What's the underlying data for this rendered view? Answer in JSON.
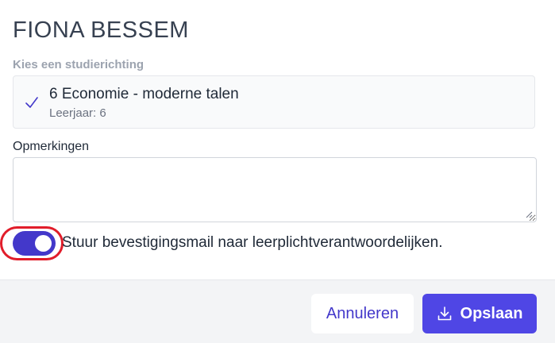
{
  "dialog": {
    "title": "FIONA BESSEM",
    "section_label": "Kies een studierichting",
    "selected_option": {
      "name": "6 Economie - moderne talen",
      "subtitle": "Leerjaar: 6",
      "icon": "check-icon"
    },
    "notes": {
      "label": "Opmerkingen",
      "value": "",
      "placeholder": ""
    },
    "confirmation_toggle": {
      "label": "Stuur bevestigingsmail naar leerplichtverantwoordelijken.",
      "enabled": true
    }
  },
  "footer": {
    "cancel_label": "Annuleren",
    "save_label": "Opslaan",
    "save_icon": "download-icon"
  },
  "colors": {
    "accent": "#4f46e5",
    "accent_dark": "#4338ca",
    "highlight_ring": "#e11d2a"
  }
}
